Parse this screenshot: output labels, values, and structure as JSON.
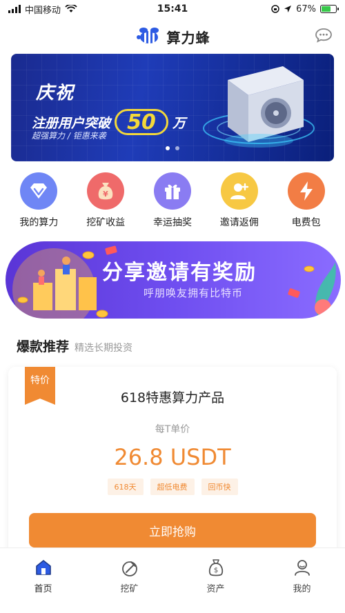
{
  "status_bar": {
    "carrier": "中国移动",
    "time": "15:41",
    "battery": "67%"
  },
  "header": {
    "app_title": "算力蜂"
  },
  "banner": {
    "title": "庆祝",
    "line_prefix": "注册用户突破",
    "highlight": "50",
    "line_suffix": "万",
    "subtitle": "超强算力 / 钜惠来袭"
  },
  "menu": [
    {
      "label": "我的算力",
      "icon": "diamond-icon",
      "color": "#6f86f5"
    },
    {
      "label": "挖矿收益",
      "icon": "money-bag-icon",
      "color": "#ef6a6a"
    },
    {
      "label": "幸运抽奖",
      "icon": "gift-icon",
      "color": "#8a7cf2"
    },
    {
      "label": "邀请返佣",
      "icon": "user-add-icon",
      "color": "#f7c843"
    },
    {
      "label": "电费包",
      "icon": "lightning-icon",
      "color": "#f27d45"
    }
  ],
  "invite_banner": {
    "title": "分享邀请有奖励",
    "subtitle": "呼朋唤友拥有比特币"
  },
  "section": {
    "title": "爆款推荐",
    "subtitle": "精选长期投资"
  },
  "product": {
    "ribbon": "特价",
    "title": "618特惠算力产品",
    "unit_label": "每T单价",
    "price": "26.8 USDT",
    "tags": [
      "618天",
      "超低电费",
      "回币快"
    ],
    "buy_label": "立即抢购"
  },
  "tabbar": [
    {
      "label": "首页",
      "icon": "home-icon",
      "active": true
    },
    {
      "label": "挖矿",
      "icon": "pickaxe-icon",
      "active": false
    },
    {
      "label": "资产",
      "icon": "money-bag-icon",
      "active": false
    },
    {
      "label": "我的",
      "icon": "profile-icon",
      "active": false
    }
  ],
  "colors": {
    "accent": "#f08a33",
    "brand": "#2d5be3"
  }
}
